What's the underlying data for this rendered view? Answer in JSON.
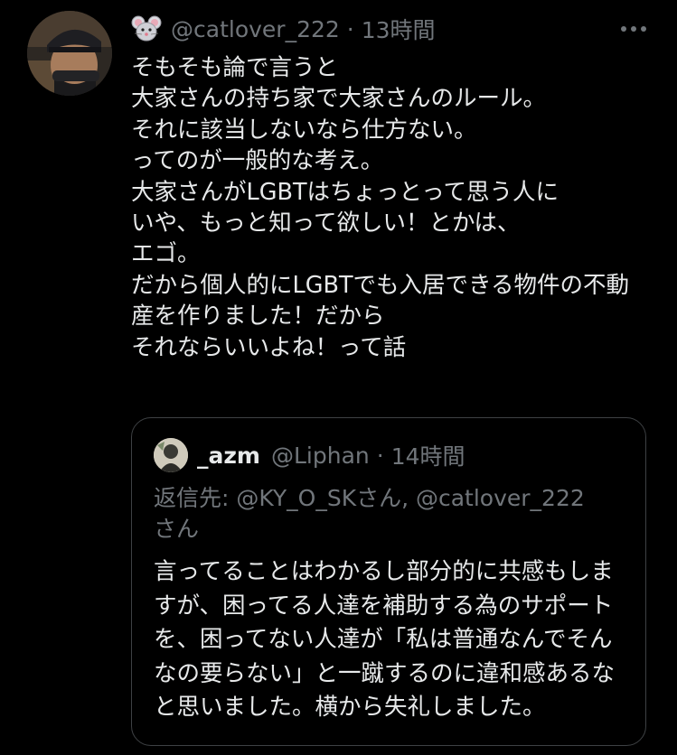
{
  "tweet": {
    "handle": "@catlover_222",
    "separator": "·",
    "time": "13時間",
    "body_lines": [
      "そもそも論で言うと",
      "大家さんの持ち家で大家さんのルール。",
      "それに該当しないなら仕方ない。",
      "ってのが一般的な考え。",
      "大家さんがLGBTはちょっとって思う人に",
      "いや、もっと知って欲しい！とかは、",
      "エゴ。",
      "だから個人的にLGBTでも入居できる物件の不動",
      "産を作りました！だから",
      "それならいいよね！って話"
    ]
  },
  "quoted": {
    "name": "_azm",
    "handle": "@Liphan",
    "separator": "·",
    "time": "14時間",
    "reply_lines": [
      "返信先: @KY_O_SKさん, @catlover_222",
      "さん"
    ],
    "body_lines": [
      "言ってることはわかるし部分的に共感もしま",
      "すが、困ってる人達を補助する為のサポート",
      "を、困ってない人達が「私は普通なんでそん",
      "なの要らない」と一蹴するのに違和感あるな",
      "と思いました。横から失礼しました。"
    ]
  },
  "icons": {
    "user_emoji": "mouse-face-icon",
    "more": "more-options-icon"
  },
  "colors": {
    "background": "#000000",
    "text_primary": "#e7e9ea",
    "text_secondary": "#71767b",
    "quote_border": "#3e4144"
  }
}
